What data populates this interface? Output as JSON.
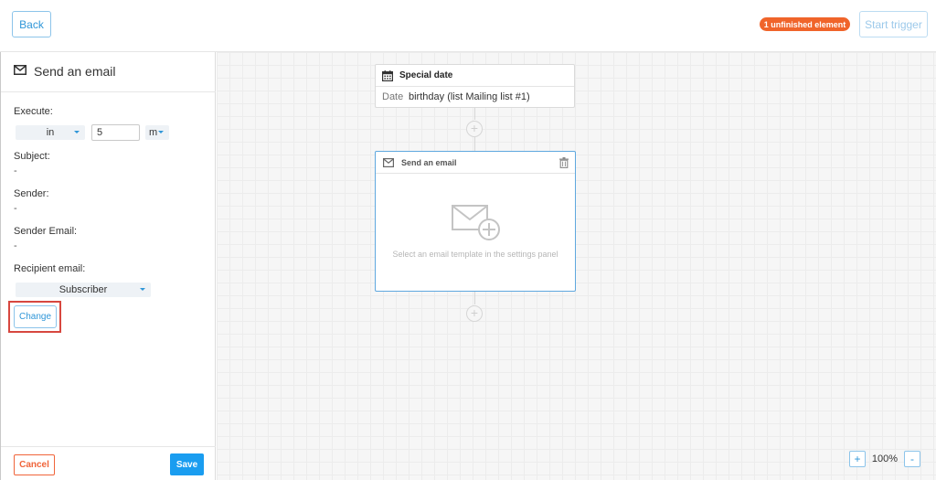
{
  "topbar": {
    "back_label": "Back",
    "unfinished_badge": "1 unfinished element",
    "start_trigger_label": "Start trigger"
  },
  "panel": {
    "title": "Send an email",
    "title_icon": "envelope-icon",
    "execute_label": "Execute:",
    "execute_when": "in",
    "execute_amount": "5",
    "execute_unit": "m",
    "subject_label": "Subject:",
    "subject_value": "-",
    "sender_label": "Sender:",
    "sender_value": "-",
    "sender_email_label": "Sender Email:",
    "sender_email_value": "-",
    "recipient_label": "Recipient email:",
    "recipient_value": "Subscriber",
    "change_label": "Change",
    "cancel_label": "Cancel",
    "save_label": "Save"
  },
  "canvas": {
    "special_node": {
      "title": "Special date",
      "icon": "calendar-icon",
      "date_key": "Date",
      "date_value": "birthday (list Mailing list #1)"
    },
    "email_node": {
      "title": "Send an email",
      "icon": "envelope-icon",
      "hint": "Select an email template in the settings panel"
    },
    "zoom": {
      "plus": "+",
      "level": "100%",
      "minus": "-"
    }
  },
  "colors": {
    "accent": "#2f96d8",
    "badge": "#f0642a",
    "cancel": "#f0643a",
    "save": "#1a9df0",
    "highlight": "#d7473f"
  }
}
